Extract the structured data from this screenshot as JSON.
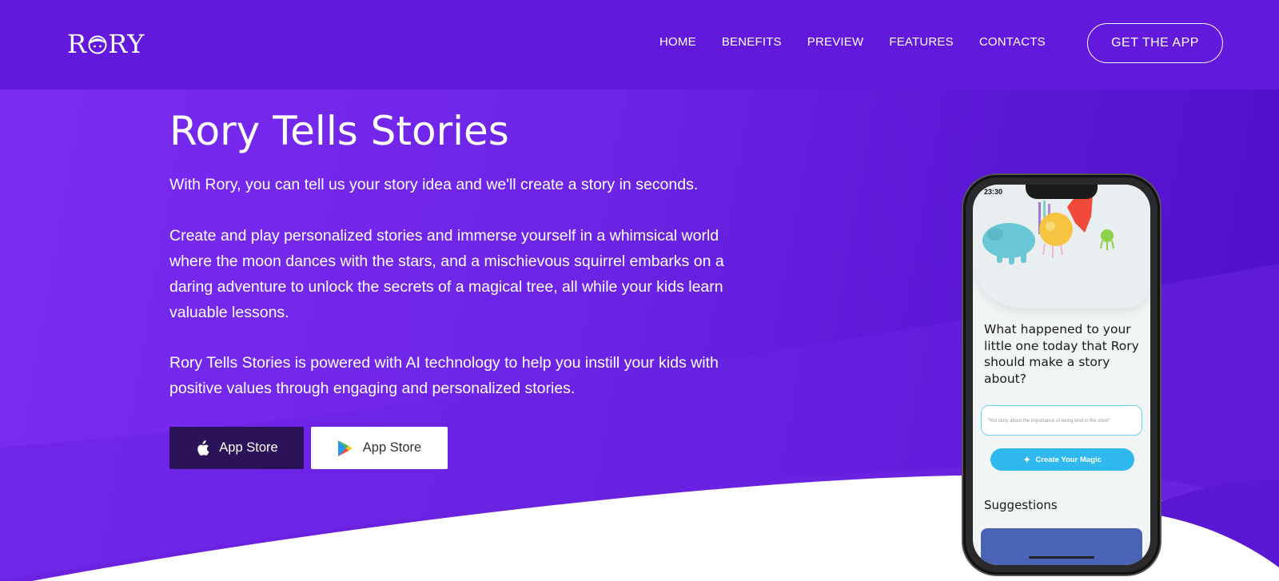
{
  "header": {
    "logo": {
      "prefix": "R",
      "suffix": "RY"
    },
    "nav": [
      "HOME",
      "BENEFITS",
      "PREVIEW",
      "FEATURES",
      "CONTACTS"
    ],
    "cta": "GET THE APP"
  },
  "hero": {
    "title": "Rory Tells Stories",
    "paragraphs": [
      "With Rory, you can tell us your story idea and we'll create a story in seconds.",
      "Create and play personalized stories and immerse yourself in a whimsical world where the moon dances with the stars, and a mischievous squirrel embarks on a daring adventure to unlock the secrets of a magical tree, all while your kids learn valuable lessons.",
      "Rory Tells Stories is powered with AI technology to help you instill your kids with positive values through engaging and personalized stories."
    ],
    "buttons": {
      "apple": "App Store",
      "google": "App Store"
    }
  },
  "phone": {
    "time": "23:30",
    "question": "What happened to your little one today that Rory should make a story about?",
    "placeholder": "\"Kid story about the importance of being kind in the store\"",
    "button": "Create Your Magic",
    "suggestions": "Suggestions"
  },
  "colors": {
    "header": "#6319db",
    "hero_left": "#7b2cf2",
    "hero_right": "#4f10c9",
    "apple_button": "#2c1258",
    "magic_button": "#2fb9ee"
  }
}
